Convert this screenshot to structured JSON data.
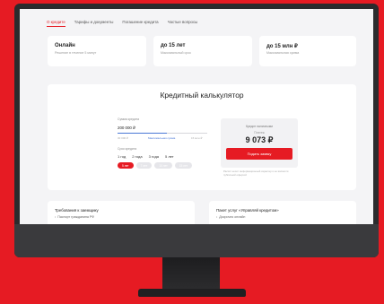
{
  "nav": {
    "tabs": [
      "О кредите",
      "Тарифы и документы",
      "Погашение кредита",
      "Частые вопросы"
    ],
    "active_index": 0
  },
  "info_cards": [
    {
      "title": "Онлайн",
      "subtitle": "Решение в течение 5 минут"
    },
    {
      "title": "до 15 лет",
      "subtitle": "Максимальный срок"
    },
    {
      "title": "до 15 млн ₽",
      "subtitle": "Максимальная сумма"
    }
  ],
  "calculator": {
    "title": "Кредитный калькулятор",
    "amount_label": "Сумма кредита",
    "amount_value": "200 000 ₽",
    "amount_min": "30 000 ₽",
    "amount_max": "15 млн ₽",
    "amount_mid": "Максимальная сумма",
    "amount_fraction": 0.55,
    "term_label": "Срок кредита",
    "terms": [
      "1 год",
      "2 года",
      "3 года",
      "5 лет"
    ],
    "pills": [
      "5 лет",
      "7 лет",
      "10 лет",
      "15 лет"
    ],
    "active_pill_index": 0,
    "result": {
      "title": "Кредит наличными",
      "label": "Платеж",
      "amount": "9 073 ₽",
      "button": "Подать заявку"
    },
    "fine_print": "Расчёт носит информационный характер и не является публичной офертой"
  },
  "bottom_cards": [
    {
      "title": "Требования к заемщику",
      "item": "Паспорт гражданина РФ"
    },
    {
      "title": "Пакет услуг «Управляй кредитом»",
      "item": "Досрочно онлайн"
    }
  ],
  "colors": {
    "brand": "#e61b23",
    "accent": "#4a78d6"
  }
}
